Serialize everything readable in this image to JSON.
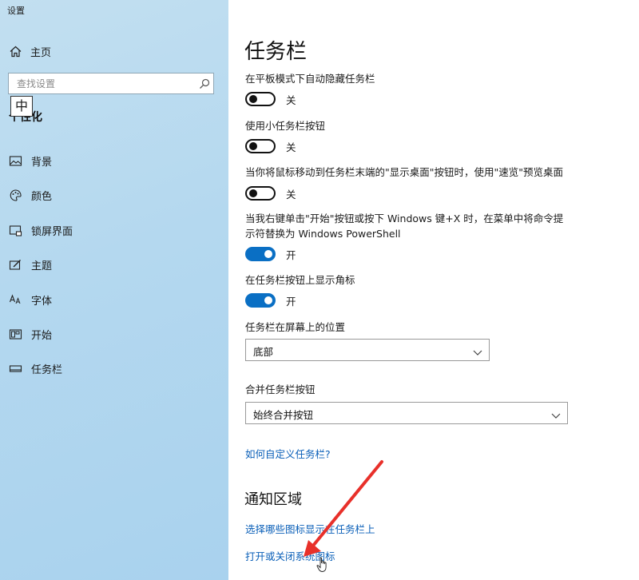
{
  "window": {
    "title": "设置"
  },
  "sidebar": {
    "home_label": "主页",
    "search": {
      "value": "",
      "placeholder": "查找设置"
    },
    "ime_indicator": "中",
    "category_title": "个性化",
    "items": [
      {
        "label": "背景",
        "icon": "picture-icon"
      },
      {
        "label": "颜色",
        "icon": "palette-icon"
      },
      {
        "label": "锁屏界面",
        "icon": "lock-screen-icon"
      },
      {
        "label": "主题",
        "icon": "theme-brush-icon"
      },
      {
        "label": "字体",
        "icon": "font-icon"
      },
      {
        "label": "开始",
        "icon": "start-menu-icon"
      },
      {
        "label": "任务栏",
        "icon": "taskbar-icon",
        "selected": true
      }
    ]
  },
  "main": {
    "title": "任务栏",
    "settings": [
      {
        "label": "在平板模式下自动隐藏任务栏",
        "state": "关",
        "on": false
      },
      {
        "label": "使用小任务栏按钮",
        "state": "关",
        "on": false
      },
      {
        "label": "当你将鼠标移动到任务栏末端的\"显示桌面\"按钮时，使用\"速览\"预览桌面",
        "state": "关",
        "on": false
      },
      {
        "label": "当我右键单击\"开始\"按钮或按下 Windows 键+X 时，在菜单中将命令提示符替换为 Windows PowerShell",
        "state": "开",
        "on": true
      },
      {
        "label": "在任务栏按钮上显示角标",
        "state": "开",
        "on": true
      }
    ],
    "position_setting": {
      "label": "任务栏在屏幕上的位置",
      "value": "底部"
    },
    "combine_setting": {
      "label": "合并任务栏按钮",
      "value": "始终合并按钮"
    },
    "help_link": "如何自定义任务栏?",
    "notification_area": {
      "title": "通知区域",
      "links": [
        "选择哪些图标显示在任务栏上",
        "打开或关闭系统图标"
      ]
    }
  },
  "colors": {
    "accent": "#0a6fc4",
    "link": "#0a5fb8",
    "sidebar_bg": "#b4d8ef",
    "annotation": "#e8302a"
  }
}
